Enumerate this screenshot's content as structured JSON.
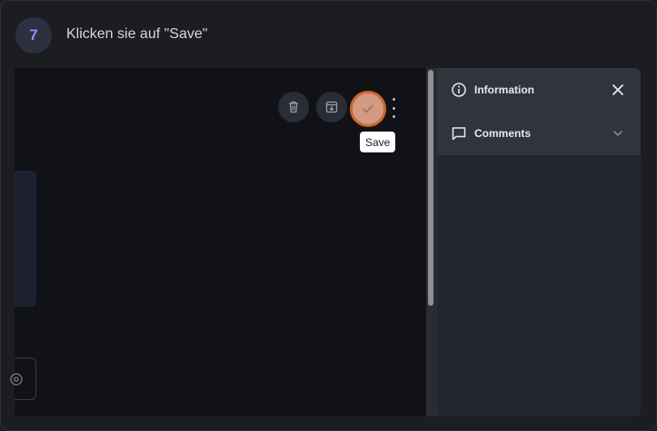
{
  "step": {
    "number": "7",
    "title": "Klicken sie auf \"Save\""
  },
  "toolbar": {
    "delete_icon": "trash-icon",
    "archive_icon": "archive-download-icon",
    "save_icon": "check-icon",
    "more_icon": "kebab-menu-icon",
    "save_tooltip": "Save"
  },
  "side_panel": {
    "information_label": "Information",
    "comments_label": "Comments",
    "information_icon": "info-circle-icon",
    "comments_icon": "comment-icon",
    "close_icon": "close-icon",
    "expand_icon": "chevron-down-icon"
  },
  "colors": {
    "accent_highlight": "#c86a2e",
    "save_fill": "#d49a86",
    "badge_text": "#8b8ff0"
  }
}
